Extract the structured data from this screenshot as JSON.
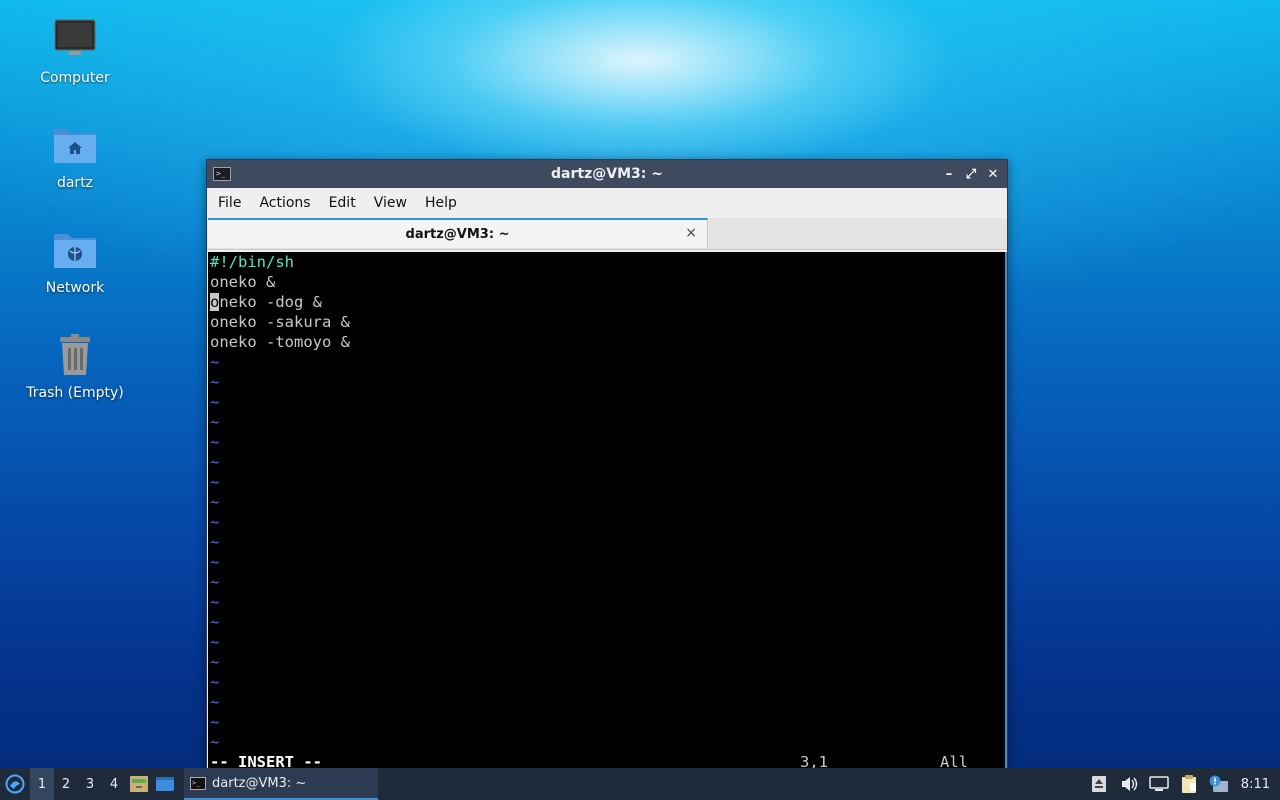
{
  "desktop": {
    "icons": [
      {
        "label": "Computer",
        "icon": "monitor-icon"
      },
      {
        "label": "dartz",
        "icon": "home-folder-icon"
      },
      {
        "label": "Network",
        "icon": "network-folder-icon"
      },
      {
        "label": "Trash (Empty)",
        "icon": "trash-icon"
      }
    ]
  },
  "window": {
    "title": "dartz@VM3: ~",
    "controls": {
      "minimize": "–",
      "maximize": "⤢",
      "close": "✕"
    },
    "menu": [
      "File",
      "Actions",
      "Edit",
      "View",
      "Help"
    ],
    "tab": {
      "label": "dartz@VM3: ~",
      "close": "×"
    }
  },
  "terminal": {
    "lines": [
      "#!/bin/sh",
      "oneko &",
      "oneko -dog &",
      "oneko -sakura &",
      "oneko -tomoyo &"
    ],
    "cursor_char": "o",
    "cursor_rest": "neko -dog &",
    "tilde": "~",
    "status": {
      "mode": "-- INSERT --",
      "position": "3,1",
      "scroll": "All"
    }
  },
  "taskbar": {
    "workspaces": [
      "1",
      "2",
      "3",
      "4"
    ],
    "active_workspace": "1",
    "task_label": "dartz@VM3: ~",
    "clock": "8:11"
  },
  "colors": {
    "accent": "#3a8fd8",
    "titlebar": "#3f4a5e",
    "taskbar": "#1f2b3b",
    "shebang": "#54e6c8",
    "tilde": "#5a6cff"
  }
}
